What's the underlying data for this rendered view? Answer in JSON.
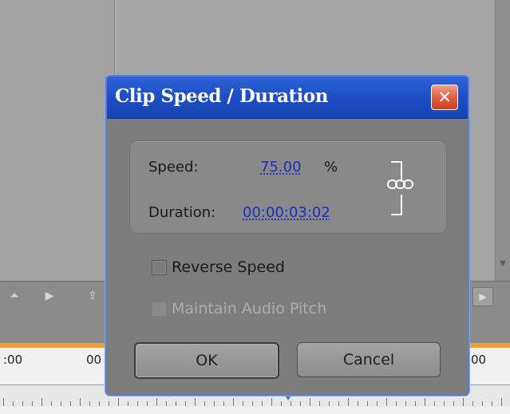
{
  "background": {
    "timecodes": [
      ":00",
      "00",
      "00"
    ],
    "right_button_icon": "play-icon"
  },
  "dialog": {
    "title": "Clip Speed / Duration",
    "close_label": "✕",
    "speed_label": "Speed:",
    "speed_value": "75.00",
    "speed_unit": "%",
    "duration_label": "Duration:",
    "duration_value": "00:00:03:02",
    "link_icon": "chain-link-icon",
    "reverse_speed_label": "Reverse Speed",
    "reverse_speed_checked": false,
    "maintain_audio_label": "Maintain Audio Pitch",
    "maintain_audio_enabled": false,
    "ok_label": "OK",
    "cancel_label": "Cancel"
  },
  "colors": {
    "title_bar": "#1e4fc7",
    "value_link": "#1b2fc2",
    "timeline_accent": "#e3a33a"
  }
}
